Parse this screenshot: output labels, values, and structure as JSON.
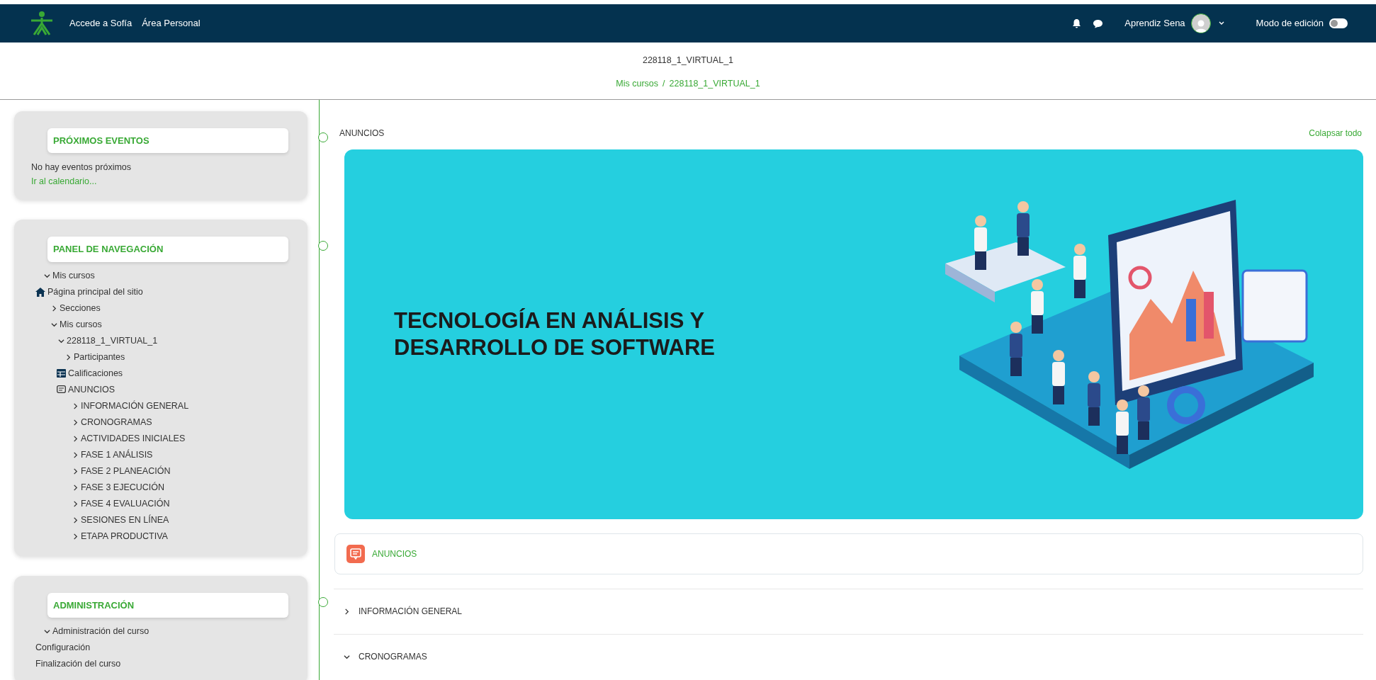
{
  "navbar": {
    "links": [
      "Accede a Sofía",
      "Área Personal"
    ],
    "user_name": "Aprendiz Sena",
    "edit_mode": {
      "label": "Modo de edición",
      "on": false
    }
  },
  "header": {
    "title": "228118_1_VIRTUAL_1",
    "breadcrumb": [
      "Mis cursos",
      "228118_1_VIRTUAL_1"
    ],
    "breadcrumb_separator": "/"
  },
  "blocks": [
    {
      "title": "PRÓXIMOS EVENTOS",
      "kind": "events",
      "text": "No hay eventos próximos",
      "link": "Ir al calendario..."
    },
    {
      "title": "PANEL DE NAVEGACIÓN",
      "kind": "tree",
      "items": [
        {
          "label": "Mis cursos",
          "kind": "toggle",
          "expanded": true
        },
        {
          "label": "Página principal del sitio",
          "kind": "home",
          "children": [
            {
              "label": "Secciones",
              "kind": "toggle",
              "expanded": false
            },
            {
              "label": "Mis cursos",
              "kind": "toggle",
              "expanded": true,
              "children": [
                {
                  "label": "228118_1_VIRTUAL_1",
                  "kind": "toggle",
                  "expanded": true,
                  "children": [
                    {
                      "label": "Participantes",
                      "kind": "toggle",
                      "expanded": false
                    },
                    {
                      "label": "Calificaciones",
                      "kind": "grades"
                    },
                    {
                      "label": "ANUNCIOS",
                      "kind": "forum",
                      "children": [
                        {
                          "label": "INFORMACIÓN GENERAL",
                          "kind": "toggle",
                          "expanded": false
                        },
                        {
                          "label": "CRONOGRAMAS",
                          "kind": "toggle",
                          "expanded": false
                        },
                        {
                          "label": "ACTIVIDADES INICIALES",
                          "kind": "toggle",
                          "expanded": false
                        },
                        {
                          "label": "FASE 1 ANÁLISIS",
                          "kind": "toggle",
                          "expanded": false
                        },
                        {
                          "label": "FASE 2 PLANEACIÓN",
                          "kind": "toggle",
                          "expanded": false
                        },
                        {
                          "label": "FASE 3 EJECUCIÓN",
                          "kind": "toggle",
                          "expanded": false
                        },
                        {
                          "label": "FASE 4 EVALUACIÓN",
                          "kind": "toggle",
                          "expanded": false
                        },
                        {
                          "label": "SESIONES EN LÍNEA",
                          "kind": "toggle",
                          "expanded": false
                        },
                        {
                          "label": "ETAPA PRODUCTIVA",
                          "kind": "toggle",
                          "expanded": false
                        }
                      ]
                    }
                  ]
                }
              ]
            }
          ]
        }
      ]
    },
    {
      "title": "ADMINISTRACIÓN",
      "kind": "tree",
      "items": [
        {
          "label": "Administración del curso",
          "kind": "toggle",
          "expanded": true
        },
        {
          "label": "Configuración",
          "kind": "link"
        },
        {
          "label": "Finalización del curso",
          "kind": "link"
        }
      ]
    }
  ],
  "main": {
    "section_title": "ANUNCIOS",
    "collapse_link": "Colapsar todo",
    "banner_heading": [
      "TECNOLOGÍA EN ANÁLISIS Y",
      "DESARROLLO DE SOFTWARE"
    ],
    "activity": "ANUNCIOS",
    "sections": [
      {
        "label": "INFORMACIÓN GENERAL",
        "expanded": false
      },
      {
        "label": "CRONOGRAMAS",
        "expanded": true
      }
    ]
  }
}
